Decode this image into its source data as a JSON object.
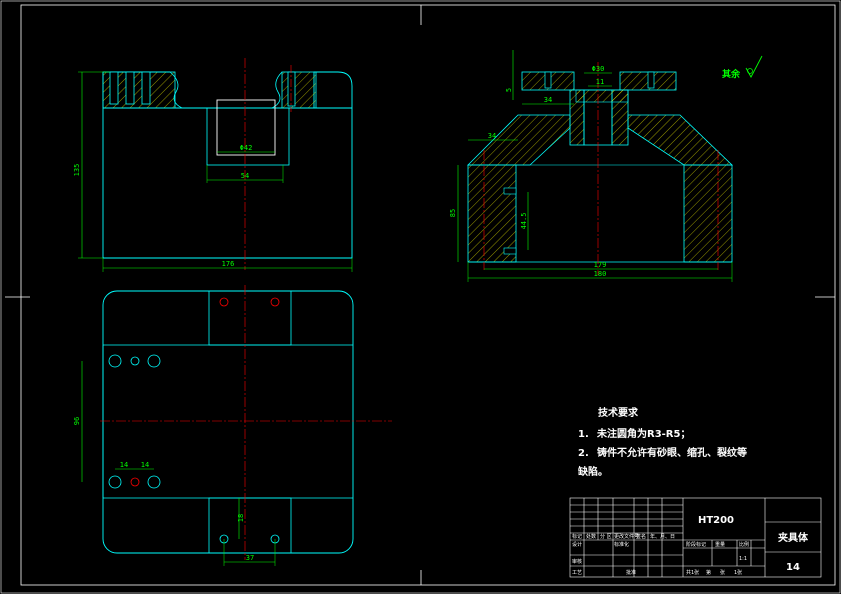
{
  "views": {
    "front": {
      "dims": {
        "height_left": "135",
        "bore": "Φ42",
        "slot_width": "54",
        "overall_width": "176"
      }
    },
    "section": {
      "dims": {
        "top_bore": "Φ30",
        "top_small": "11",
        "top_span": "34",
        "top_vertical": "5",
        "left_chamfer": "34",
        "height": "85",
        "hole_depth": "44.5",
        "inner_width": "179",
        "overall_width": "180"
      }
    },
    "top": {
      "dims": {
        "hole_spacing": "96",
        "left_a": "14",
        "left_b": "14",
        "bottom_vertical": "18",
        "bottom_span": "37"
      }
    }
  },
  "roughness": {
    "label": "其余"
  },
  "technical_requirements": {
    "title": "技术要求",
    "items": [
      {
        "num": "1.",
        "text": "未注圆角为R3-R5；"
      },
      {
        "num": "2.",
        "text": "铸件不允许有砂眼、缩孔、裂纹等"
      }
    ],
    "continuation": "缺陷。"
  },
  "title_block": {
    "material": "HT200",
    "part_name": "夹具体",
    "drawing_no": "14",
    "row_labels": [
      "标记",
      "处数",
      "分 区",
      "更改文件号",
      "签名",
      "年、月、日"
    ],
    "left_labels": [
      "设计",
      "审核",
      "工艺"
    ],
    "std_label": "标准化",
    "approve_label": "批准",
    "stage_headers": [
      "阶段标记",
      "重量",
      "比例"
    ],
    "scale": "1:1",
    "sheet_info": [
      "共1张",
      "第",
      "张",
      "1张"
    ]
  },
  "colors": {
    "outline": "#00ffff",
    "dim": "#00ff00",
    "center": "#ff0000",
    "hatch": "#ffff00",
    "white": "#ffffff",
    "hidden": "#ff00ff"
  }
}
